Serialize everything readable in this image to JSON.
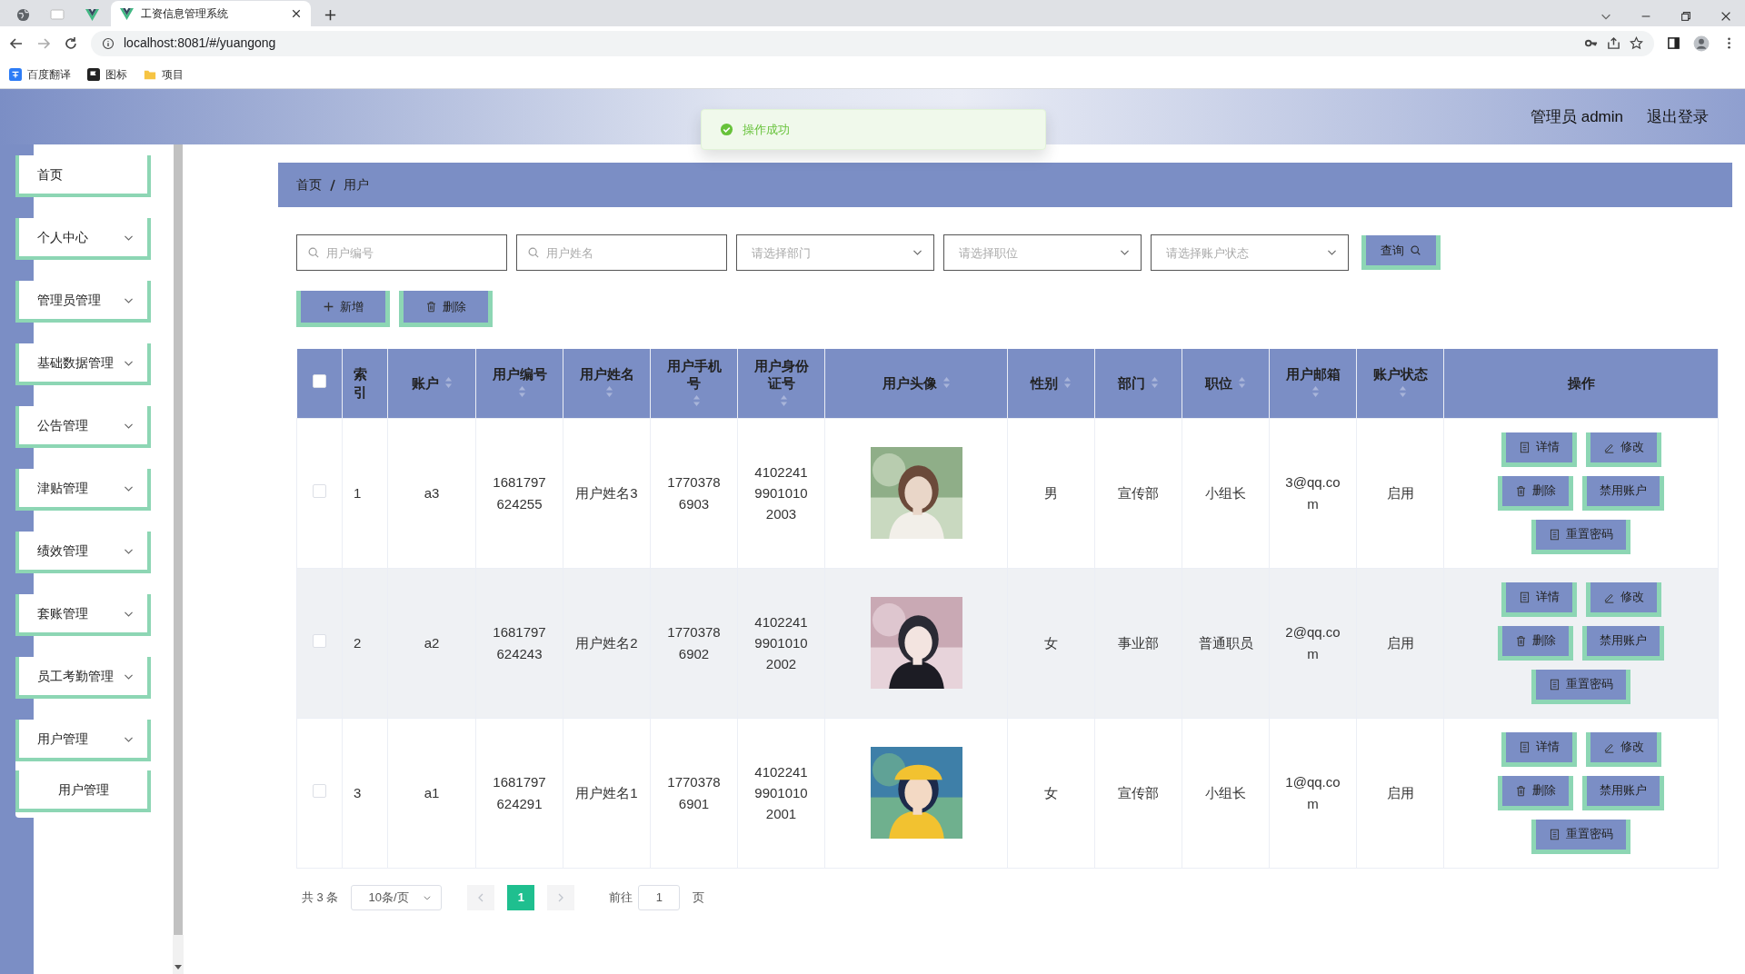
{
  "browser": {
    "active_tab": {
      "title": "工资信息管理系统"
    },
    "address": "localhost:8081/#/yuangong",
    "bookmarks": [
      {
        "label": "百度翻译",
        "kind": "translate"
      },
      {
        "label": "图标",
        "kind": "flag"
      },
      {
        "label": "项目",
        "kind": "folder"
      }
    ]
  },
  "header": {
    "user": "管理员 admin",
    "logout": "退出登录"
  },
  "toast": {
    "message": "操作成功"
  },
  "sidebar": {
    "items": [
      {
        "label": "首页",
        "kind": "link"
      },
      {
        "label": "个人中心",
        "kind": "menu"
      },
      {
        "label": "管理员管理",
        "kind": "menu"
      },
      {
        "label": "基础数据管理",
        "kind": "menu"
      },
      {
        "label": "公告管理",
        "kind": "menu"
      },
      {
        "label": "津贴管理",
        "kind": "menu"
      },
      {
        "label": "绩效管理",
        "kind": "menu"
      },
      {
        "label": "套账管理",
        "kind": "menu"
      },
      {
        "label": "员工考勤管理",
        "kind": "menu"
      },
      {
        "label": "用户管理",
        "kind": "menu",
        "children": [
          {
            "label": "用户管理"
          }
        ]
      }
    ]
  },
  "breadcrumb": [
    "首页",
    "用户"
  ],
  "filters": [
    {
      "kind": "input",
      "placeholder": "用户编号"
    },
    {
      "kind": "input",
      "placeholder": "用户姓名"
    },
    {
      "kind": "select",
      "placeholder": "请选择部门"
    },
    {
      "kind": "select",
      "placeholder": "请选择职位"
    },
    {
      "kind": "select",
      "placeholder": "请选择账户状态"
    }
  ],
  "query_button": "查询",
  "toolbar": [
    {
      "label": "新增",
      "kind": "add"
    },
    {
      "label": "删除",
      "kind": "delete"
    }
  ],
  "table": {
    "select_all": {
      "checked": false
    },
    "columns": [
      {
        "label": "索引",
        "sortable": false
      },
      {
        "label": "账户",
        "sortable": true
      },
      {
        "label": "用户编号",
        "sortable": true
      },
      {
        "label": "用户姓名",
        "sortable": true
      },
      {
        "label": "用户手机号",
        "sortable": true
      },
      {
        "label": "用户身份证号",
        "sortable": true
      },
      {
        "label": "用户头像",
        "sortable": true
      },
      {
        "label": "性别",
        "sortable": true
      },
      {
        "label": "部门",
        "sortable": true
      },
      {
        "label": "职位",
        "sortable": true
      },
      {
        "label": "用户邮箱",
        "sortable": true
      },
      {
        "label": "账户状态",
        "sortable": true
      },
      {
        "label": "操作",
        "sortable": false
      }
    ],
    "rows": [
      {
        "checked": false,
        "highlighted": false,
        "cells": [
          "1",
          "a3",
          "1681797624255",
          "用户姓名3",
          "17703786903",
          "410224199010102003",
          {
            "kind": "picture"
          },
          "男",
          "宣传部",
          "小组长",
          "3@qq.com",
          "启用"
        ],
        "actions": [
          {
            "label": "详情",
            "kind": "detail"
          },
          {
            "label": "修改",
            "kind": "edit"
          },
          {
            "label": "删除",
            "kind": "delete"
          },
          {
            "label": "禁用账户",
            "kind": "disable"
          },
          {
            "label": "重置密码",
            "kind": "reset"
          }
        ]
      },
      {
        "checked": false,
        "highlighted": true,
        "cells": [
          "2",
          "a2",
          "1681797624243",
          "用户姓名2",
          "17703786902",
          "410224199010102002",
          {
            "kind": "picture"
          },
          "女",
          "事业部",
          "普通职员",
          "2@qq.com",
          "启用"
        ],
        "actions": [
          {
            "label": "详情",
            "kind": "detail"
          },
          {
            "label": "修改",
            "kind": "edit"
          },
          {
            "label": "删除",
            "kind": "delete"
          },
          {
            "label": "禁用账户",
            "kind": "disable"
          },
          {
            "label": "重置密码",
            "kind": "reset"
          }
        ]
      },
      {
        "checked": false,
        "highlighted": false,
        "cells": [
          "3",
          "a1",
          "1681797624291",
          "用户姓名1",
          "17703786901",
          "410224199010102001",
          {
            "kind": "picture"
          },
          "女",
          "宣传部",
          "小组长",
          "1@qq.com",
          "启用"
        ],
        "actions": [
          {
            "label": "详情",
            "kind": "detail"
          },
          {
            "label": "修改",
            "kind": "edit"
          },
          {
            "label": "删除",
            "kind": "delete"
          },
          {
            "label": "禁用账户",
            "kind": "disable"
          },
          {
            "label": "重置密码",
            "kind": "reset"
          }
        ]
      }
    ]
  },
  "pagination": {
    "total": "共 3 条",
    "page_size": "10条/页",
    "prev_disabled": true,
    "next_disabled": true,
    "pages": [
      {
        "label": "1",
        "selected": true
      }
    ],
    "goto_label": "前往",
    "goto_value": "1",
    "goto_suffix": "页"
  }
}
